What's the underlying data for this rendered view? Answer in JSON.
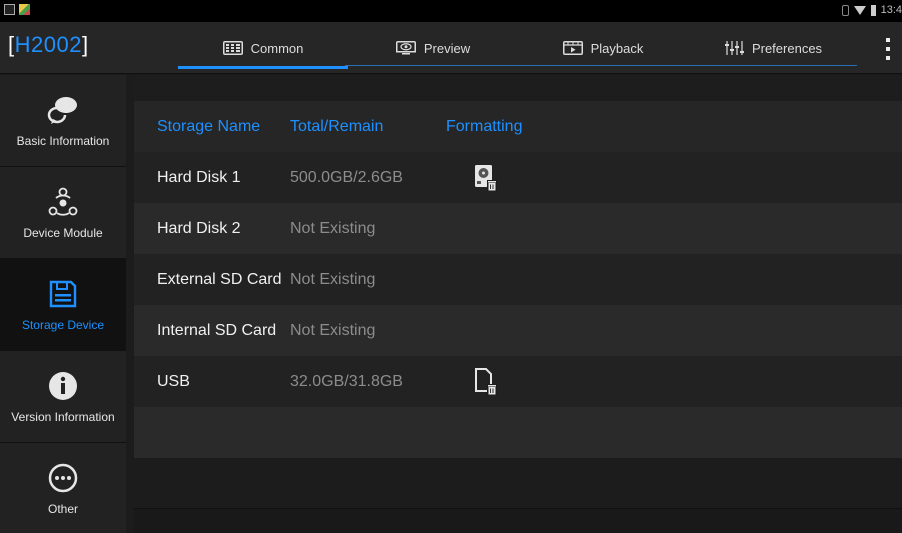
{
  "status_bar": {
    "time": "13:4"
  },
  "header": {
    "brand_bracket_open": "[",
    "brand_name": "H2002",
    "brand_bracket_close": "]",
    "tabs": [
      {
        "label": "Common",
        "icon": "grid-icon",
        "active": true
      },
      {
        "label": "Preview",
        "icon": "eye-icon",
        "active": false
      },
      {
        "label": "Playback",
        "icon": "film-icon",
        "active": false
      },
      {
        "label": "Preferences",
        "icon": "sliders-icon",
        "active": false
      }
    ]
  },
  "sidebar": {
    "items": [
      {
        "label": "Basic Information",
        "icon": "speech-bubbles-icon"
      },
      {
        "label": "Device Module",
        "icon": "module-network-icon"
      },
      {
        "label": "Storage Device",
        "icon": "floppy-disk-icon",
        "active": true
      },
      {
        "label": "Version Information",
        "icon": "info-icon"
      },
      {
        "label": "Other",
        "icon": "more-dots-icon"
      }
    ]
  },
  "table": {
    "columns": [
      "Storage Name",
      "Total/Remain",
      "Formatting"
    ],
    "rows": [
      {
        "name": "Hard Disk 1",
        "capacity": "500.0GB/2.6GB",
        "format_icon": "hdd-format-icon"
      },
      {
        "name": "Hard Disk 2",
        "capacity": "Not Existing"
      },
      {
        "name": "External SD Card",
        "capacity": "Not Existing"
      },
      {
        "name": "Internal SD Card",
        "capacity": "Not Existing"
      },
      {
        "name": "USB",
        "capacity": "32.0GB/31.8GB",
        "format_icon": "file-delete-icon"
      }
    ]
  },
  "colors": {
    "accent": "#1e90ff",
    "background": "#1c1c1c"
  }
}
